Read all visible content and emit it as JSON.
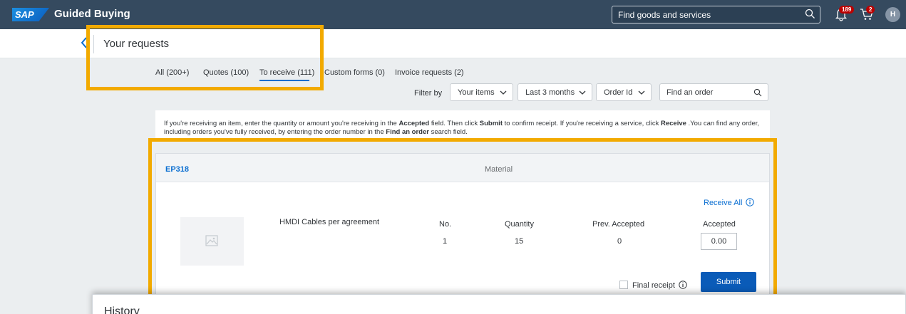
{
  "shell": {
    "logo_text": "SAP",
    "app_title": "Guided Buying",
    "search_placeholder": "Find goods and services",
    "notifications_count": "189",
    "cart_count": "2",
    "avatar_initial": "H"
  },
  "header": {
    "title": "Your requests"
  },
  "tabs": [
    {
      "label": "All (200+)"
    },
    {
      "label": "Quotes (100)"
    },
    {
      "label": "To receive (111)",
      "active": true
    },
    {
      "label": "Custom forms (0)"
    },
    {
      "label": "Invoice requests (2)"
    }
  ],
  "filters": {
    "label": "Filter by",
    "items_filter": "Your items",
    "period_filter": "Last 3 months",
    "id_filter": "Order Id",
    "order_search_placeholder": "Find an order"
  },
  "info": {
    "part1": "If you're receiving an item, enter the quantity or amount you're receiving in the ",
    "accepted": "Accepted",
    "part2": " field. Then click ",
    "submit": "Submit",
    "part3": " to confirm receipt. If you're receiving a service, click ",
    "receive": "Receive",
    "part4": " .You can find any order, including orders you've fully received, by entering the order number in the ",
    "find_order": "Find an order",
    "part5": " search field."
  },
  "order": {
    "id": "EP318",
    "type": "Material",
    "receive_all": "Receive All",
    "item_name": "HMDI Cables per agreement",
    "columns": {
      "no": "No.",
      "quantity": "Quantity",
      "prev_accepted": "Prev. Accepted",
      "accepted": "Accepted"
    },
    "values": {
      "no": "1",
      "quantity": "15",
      "prev_accepted": "0",
      "accepted": "0.00"
    },
    "final_receipt": "Final receipt",
    "submit_label": "Submit"
  },
  "history": {
    "title": "History"
  },
  "colors": {
    "shellbar": "#354a5f",
    "accent": "#0a6ed1",
    "highlight": "#f2aa00",
    "badge": "#bb0000"
  }
}
